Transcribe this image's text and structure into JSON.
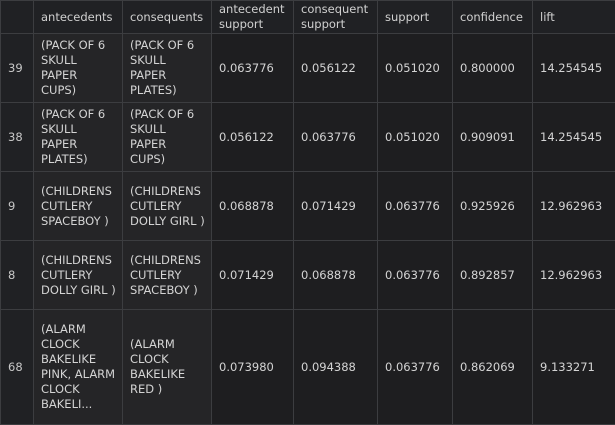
{
  "table": {
    "columns": [
      "antecedents",
      "consequents",
      "antecedent support",
      "consequent support",
      "support",
      "confidence",
      "lift"
    ],
    "rows": [
      {
        "index": "39",
        "antecedents": "(PACK OF 6 SKULL PAPER CUPS)",
        "consequents": "(PACK OF 6 SKULL PAPER PLATES)",
        "antecedent_support": "0.063776",
        "consequent_support": "0.056122",
        "support": "0.051020",
        "confidence": "0.800000",
        "lift": "14.254545"
      },
      {
        "index": "38",
        "antecedents": "(PACK OF 6 SKULL PAPER PLATES)",
        "consequents": "(PACK OF 6 SKULL PAPER CUPS)",
        "antecedent_support": "0.056122",
        "consequent_support": "0.063776",
        "support": "0.051020",
        "confidence": "0.909091",
        "lift": "14.254545"
      },
      {
        "index": "9",
        "antecedents": "(CHILDRENS CUTLERY SPACEBOY )",
        "consequents": "(CHILDRENS CUTLERY DOLLY GIRL )",
        "antecedent_support": "0.068878",
        "consequent_support": "0.071429",
        "support": "0.063776",
        "confidence": "0.925926",
        "lift": "12.962963"
      },
      {
        "index": "8",
        "antecedents": "(CHILDRENS CUTLERY DOLLY GIRL )",
        "consequents": "(CHILDRENS CUTLERY SPACEBOY )",
        "antecedent_support": "0.071429",
        "consequent_support": "0.068878",
        "support": "0.063776",
        "confidence": "0.892857",
        "lift": "12.962963"
      },
      {
        "index": "68",
        "antecedents": "(ALARM CLOCK BAKELIKE PINK, ALARM CLOCK BAKELI...",
        "consequents": "(ALARM CLOCK BAKELIKE RED )",
        "antecedent_support": "0.073980",
        "consequent_support": "0.094388",
        "support": "0.063776",
        "confidence": "0.862069",
        "lift": "9.133271"
      }
    ]
  }
}
